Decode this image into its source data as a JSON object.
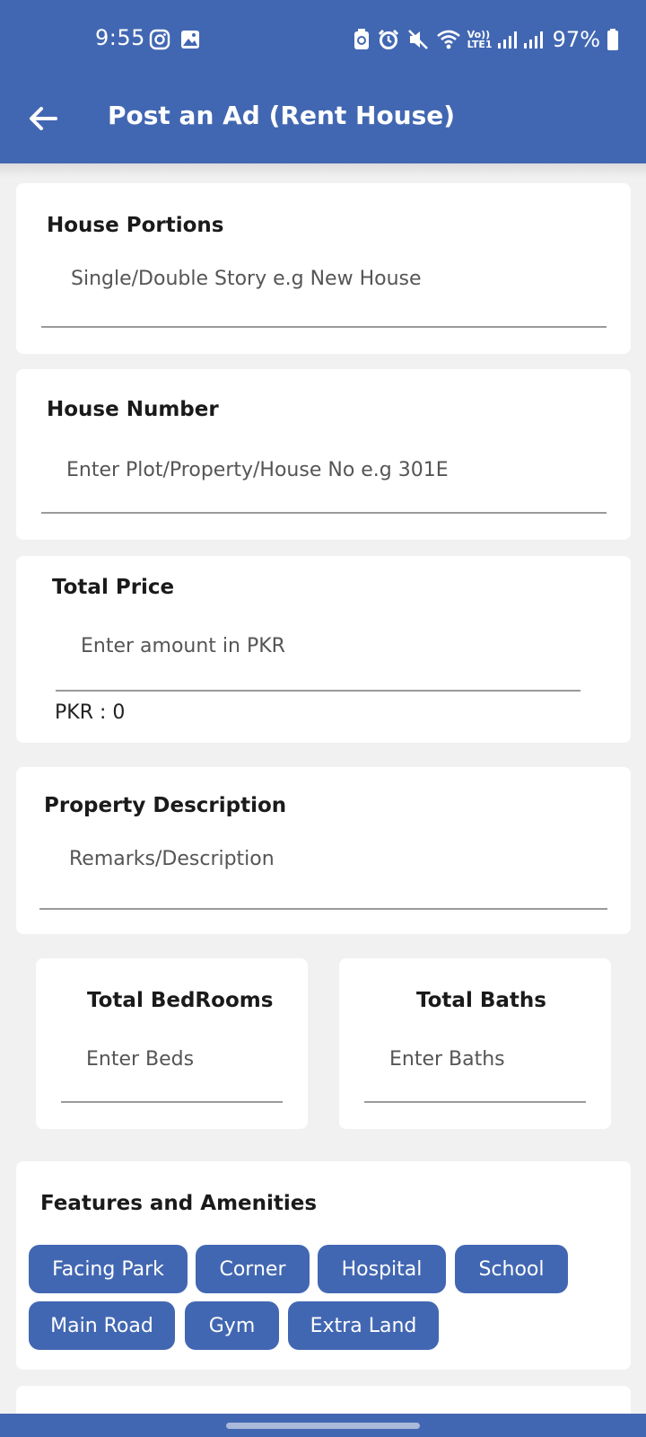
{
  "status_bar": {
    "time": "9:55",
    "battery": "97%",
    "volte_label": "Vo)) LTE1"
  },
  "app_bar": {
    "title": "Post an Ad (Rent House)",
    "back_icon": "arrow-left-icon"
  },
  "form": {
    "house_portions": {
      "label": "House Portions",
      "placeholder": "Single/Double Story e.g New House"
    },
    "house_number": {
      "label": "House Number",
      "placeholder": "Enter Plot/Property/House No e.g 301E"
    },
    "total_price": {
      "label": "Total Price",
      "placeholder": "Enter amount in PKR",
      "converted": "PKR : 0"
    },
    "property_description": {
      "label": "Property Description",
      "placeholder": "Remarks/Description"
    },
    "bedrooms": {
      "label": "Total BedRooms",
      "placeholder": "Enter Beds"
    },
    "baths": {
      "label": "Total Baths",
      "placeholder": "Enter Baths"
    }
  },
  "amenities": {
    "label": "Features and Amenities",
    "chips": [
      "Facing Park",
      "Corner",
      "Hospital",
      "School",
      "Main Road",
      "Gym",
      "Extra Land"
    ]
  },
  "colors": {
    "primary": "#4267b2",
    "background": "#f1f1f1",
    "card": "#ffffff"
  }
}
